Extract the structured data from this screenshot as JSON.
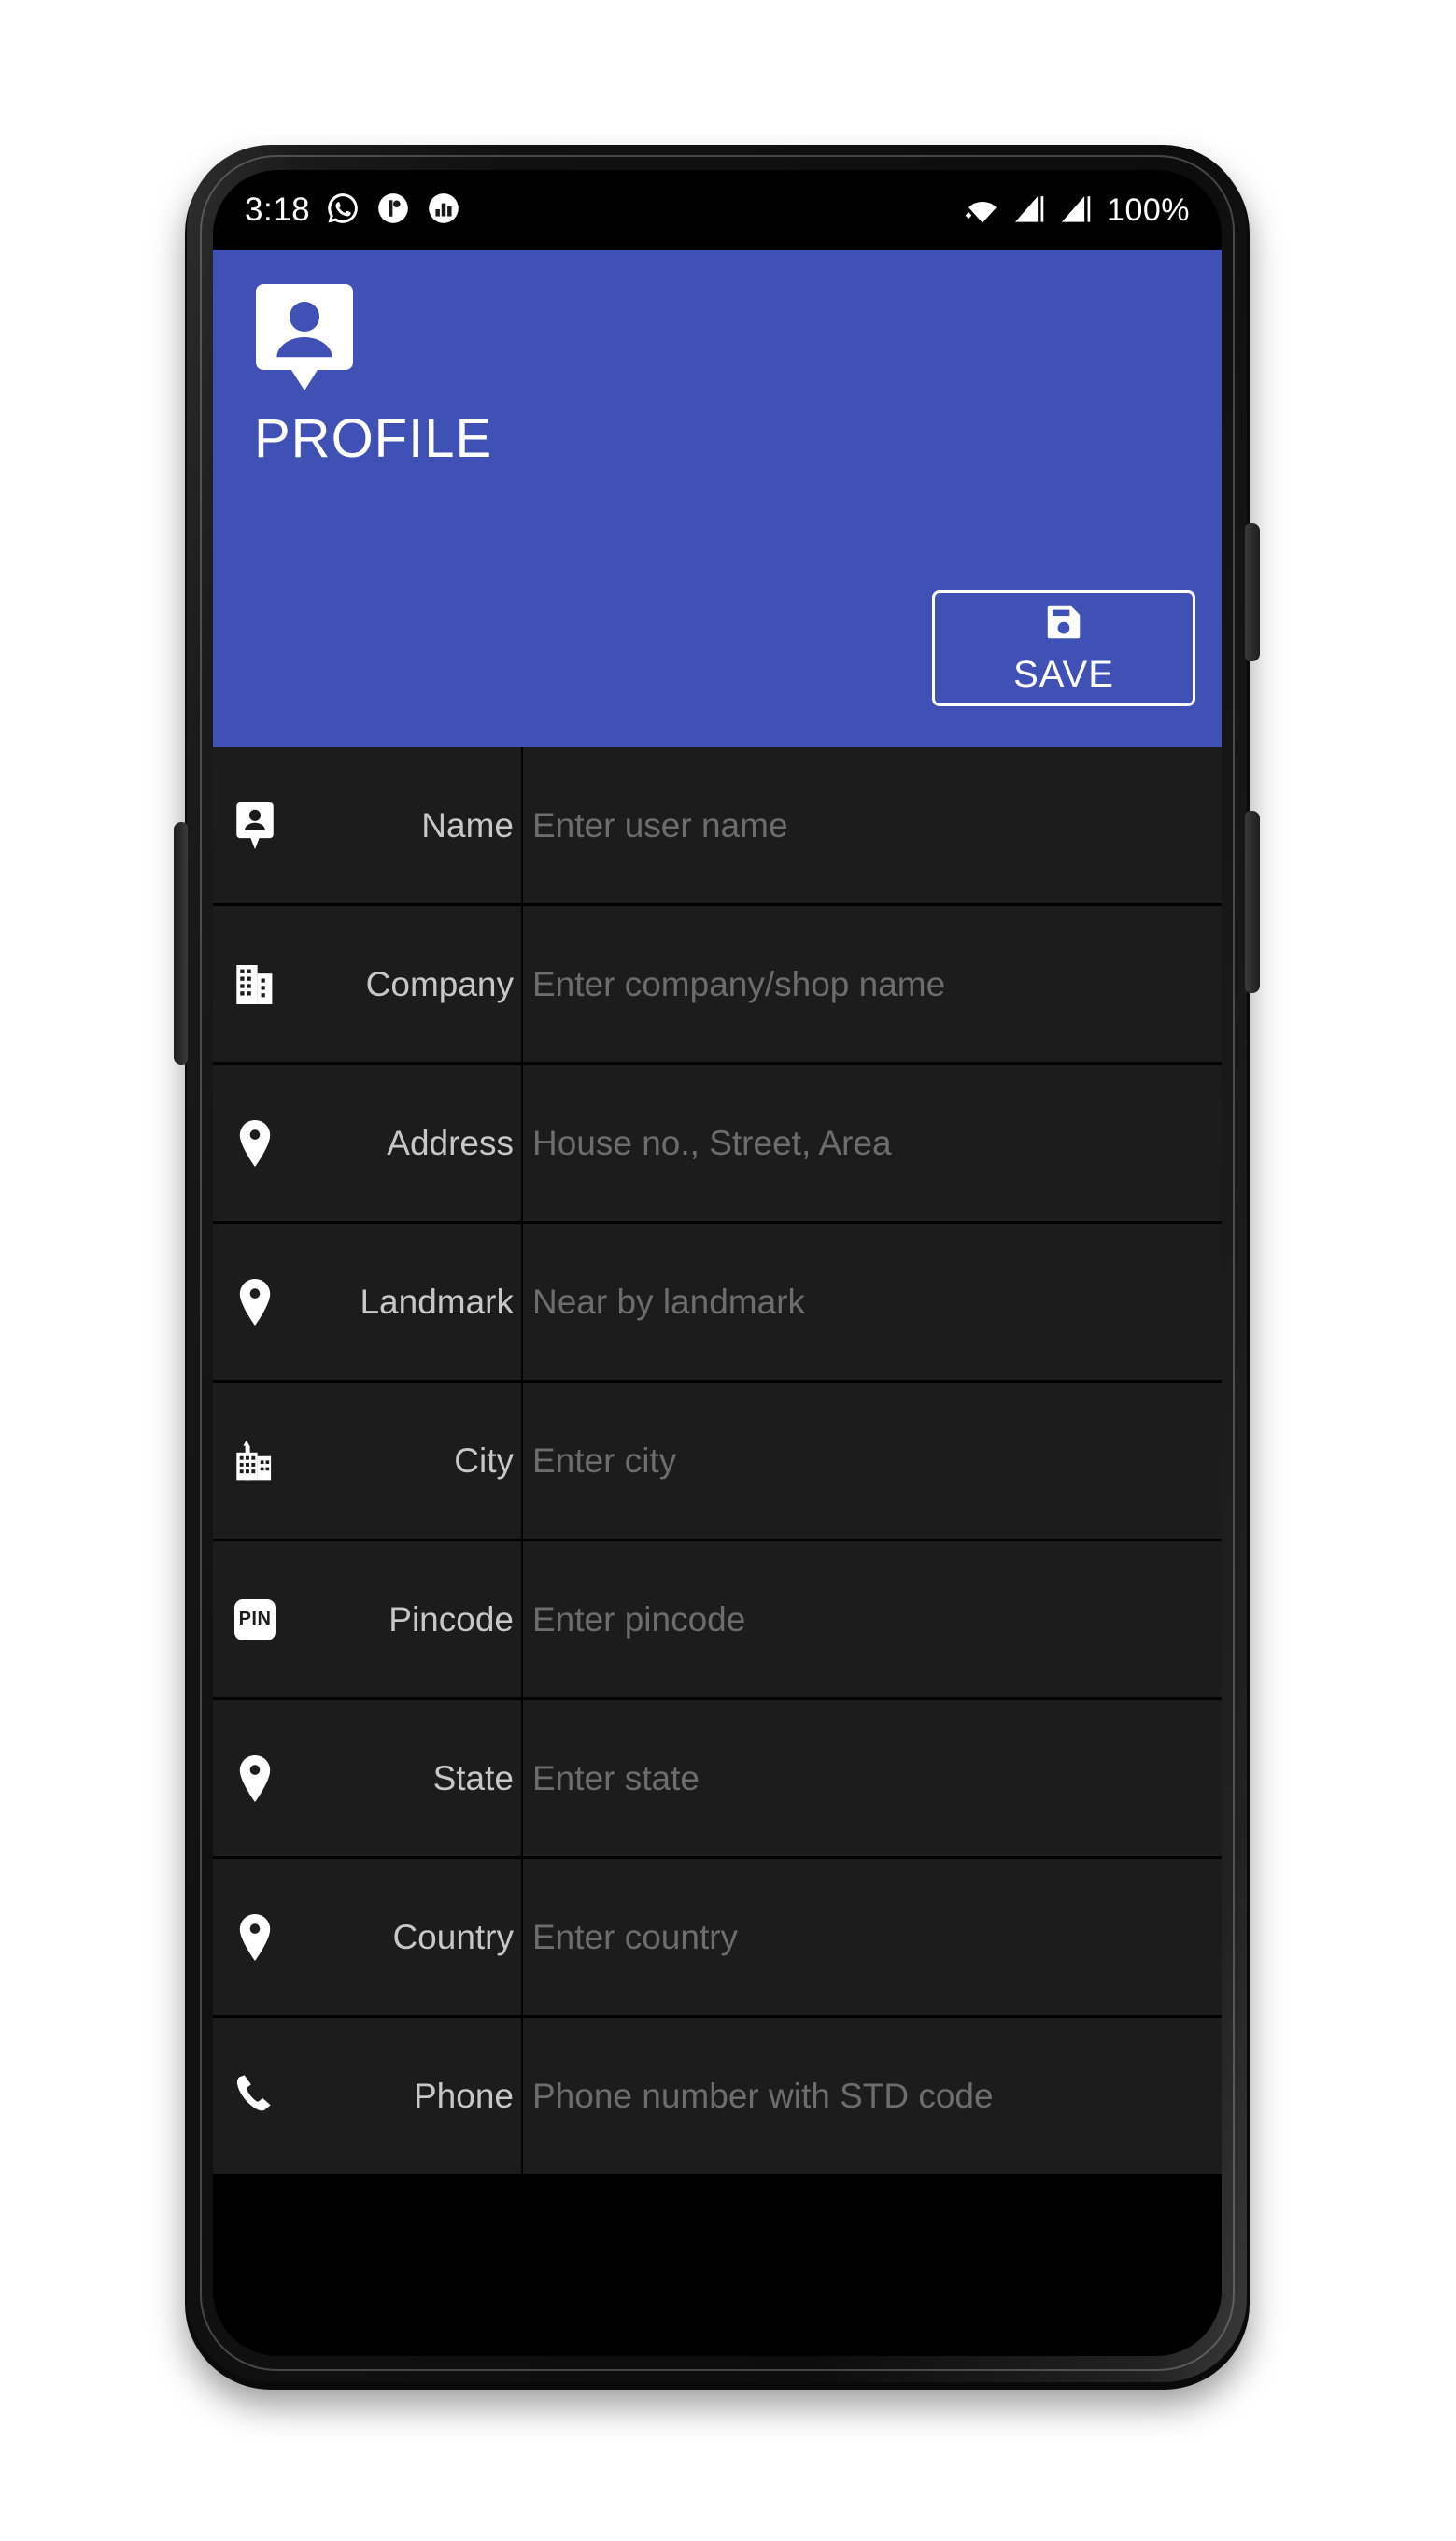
{
  "status_bar": {
    "time": "3:18",
    "battery_percent": "100%",
    "left_icons": [
      "whatsapp-icon",
      "app-notification-icon",
      "chart-notification-icon"
    ],
    "right_icons": [
      "wifi-icon",
      "signal-bars-icon",
      "signal-bars-icon"
    ]
  },
  "header": {
    "title": "PROFILE",
    "icon": "profile-badge-icon",
    "background_color": "#3f51b5",
    "save_button": {
      "label": "SAVE",
      "icon": "floppy-disk-save-icon"
    }
  },
  "form": {
    "rows": [
      {
        "label": "Name",
        "placeholder": "Enter user name",
        "value": "",
        "icon": "contact-card-icon"
      },
      {
        "label": "Company",
        "placeholder": "Enter company/shop name",
        "value": "",
        "icon": "office-building-icon"
      },
      {
        "label": "Address",
        "placeholder": "House no., Street, Area",
        "value": "",
        "icon": "map-pin-icon"
      },
      {
        "label": "Landmark",
        "placeholder": "Near by landmark",
        "value": "",
        "icon": "map-pin-icon"
      },
      {
        "label": "City",
        "placeholder": "Enter city",
        "value": "",
        "icon": "city-skyline-icon"
      },
      {
        "label": "Pincode",
        "placeholder": "Enter pincode",
        "value": "",
        "icon": "pin-code-badge-icon"
      },
      {
        "label": "State",
        "placeholder": "Enter state",
        "value": "",
        "icon": "map-pin-icon"
      },
      {
        "label": "Country",
        "placeholder": "Enter country",
        "value": "",
        "icon": "map-pin-icon"
      },
      {
        "label": "Phone",
        "placeholder": "Phone number with STD code",
        "value": "",
        "icon": "phone-handset-icon"
      }
    ]
  },
  "theme": {
    "accent": "#3f51b5",
    "row_background": "#1c1c1c",
    "screen_background": "#000000",
    "placeholder_color": "#6d6d6d",
    "label_color": "#c7c7c7"
  }
}
